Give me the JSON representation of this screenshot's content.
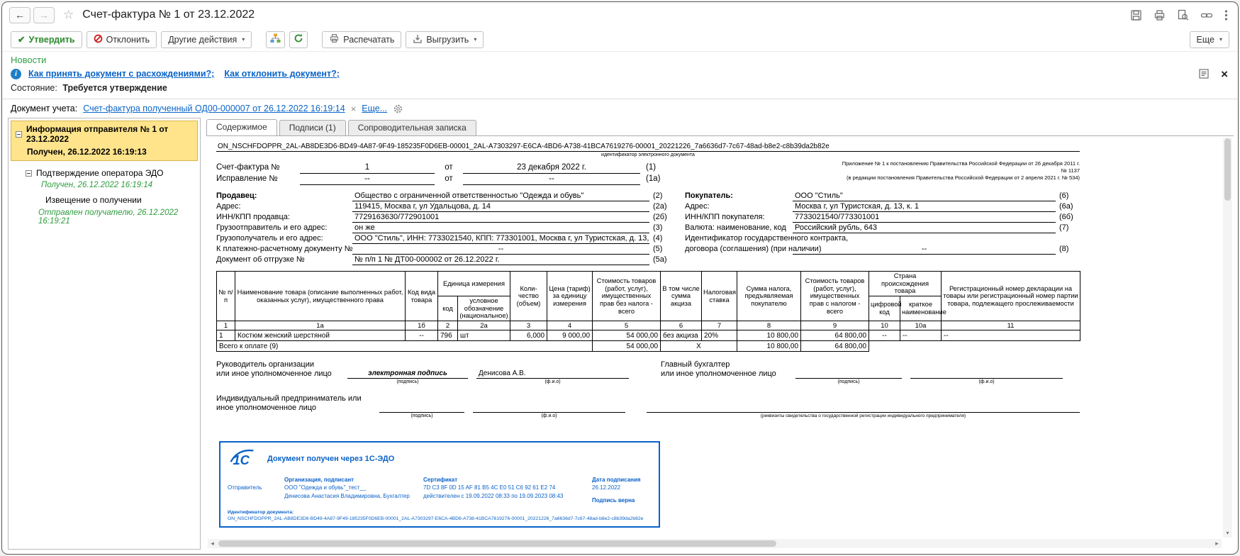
{
  "colors": {
    "accent_green": "#2e9e3e",
    "link_blue": "#0a64c8",
    "selected_yellow": "#ffe48c",
    "stamp_blue": "#0a62c8",
    "reject_red": "#cc2222"
  },
  "window": {
    "title": "Счет-фактура № 1 от 23.12.2022"
  },
  "toolbar": {
    "approve": "Утвердить",
    "reject": "Отклонить",
    "other_actions": "Другие действия",
    "print": "Распечатать",
    "export": "Выгрузить",
    "more": "Еще"
  },
  "news": {
    "title": "Новости",
    "link1": "Как принять документ с расхождениями?;",
    "link2": "Как отклонить документ?;"
  },
  "status_line": {
    "label": "Состояние:",
    "value": "Требуется утверждение"
  },
  "doc_line": {
    "label": "Документ учета:",
    "link": "Счет-фактура полученный ОД00-000007 от 26.12.2022 16:19:14",
    "close": "×",
    "more": "Еще..."
  },
  "tree": {
    "item1": {
      "title": "Информация отправителя № 1 от 23.12.2022",
      "status": "Получен, 26.12.2022 16:19:13"
    },
    "item2": {
      "title": "Подтверждение оператора ЭДО",
      "status": "Получен, 26.12.2022 16:19:14"
    },
    "item3": {
      "title": "Извещение о получении",
      "status": "Отправлен получателю, 26.12.2022 16:19:21"
    }
  },
  "tabs": {
    "t1": "Содержимое",
    "t2": "Подписи (1)",
    "t3": "Сопроводительная записка"
  },
  "invoice": {
    "doc_id": "ON_NSCHFDOPPR_2AL-AB8DE3D6-BD49-4A87-9F49-185235F0D6EB-00001_2AL-A7303297-E6CA-4BD6-A738-41BCA7619276-00001_20221226_7a6636d7-7c67-48ad-b8e2-c8b39da2b82e",
    "doc_id_caption": "идентификатор электронного документа",
    "reg1": "Приложение № 1 к постановлению Правительства Российской Федерации от 26 декабря 2011 г. № 1137",
    "reg2": "(в редакции постановления Правительства Российской Федерации от 2 апреля 2021 г. № 534)",
    "head": {
      "l1": "Счет-фактура №",
      "no": "1",
      "ot1": "от",
      "date": "23 декабря 2022 г.",
      "m1": "(1)",
      "l2": "Исправление №",
      "cno": "--",
      "ot2": "от",
      "cdate": "--",
      "m2": "(1а)"
    },
    "seller": [
      {
        "label": "Продавец:",
        "value": "Общество с ограниченной ответственностью \"Одежда и обувь\"",
        "mark": "(2)"
      },
      {
        "label": "Адрес:",
        "value": "119415, Москва г, ул Удальцова, д. 14",
        "mark": "(2а)"
      },
      {
        "label": "ИНН/КПП продавца:",
        "value": "7729163630/772901001",
        "mark": "(2б)"
      },
      {
        "label": "Грузоотправитель и его адрес:",
        "value": "он же",
        "mark": "(3)"
      },
      {
        "label": "Грузополучатель и его адрес:",
        "value": "ООО \"Стиль\", ИНН: 7733021540, КПП: 773301001, Москва г, ул Туристская, д. 13, к. 1",
        "mark": "(4)"
      },
      {
        "label": "К платежно-расчетному документу №",
        "value": "--",
        "mark": "(5)"
      },
      {
        "label": "Документ об отгрузке №",
        "value": "№ п/п 1 № ДТ00-000002 от 26.12.2022 г.",
        "mark": "(5а)"
      }
    ],
    "buyer": [
      {
        "label": "Покупатель:",
        "value": "ООО \"Стиль\"",
        "mark": "(6)"
      },
      {
        "label": "Адрес:",
        "value": "Москва г, ул Туристская, д. 13, к. 1",
        "mark": "(6а)"
      },
      {
        "label": "ИНН/КПП покупателя:",
        "value": "7733021540/773301001",
        "mark": "(6б)"
      },
      {
        "label": "Валюта: наименование, код",
        "value": "Российский рубль, 643",
        "mark": "(7)"
      },
      {
        "label": "Идентификатор государственного контракта,",
        "value": "",
        "mark": ""
      },
      {
        "label": "договора (соглашения) (при наличии)",
        "value": "--",
        "mark": "(8)"
      }
    ],
    "table": {
      "h": {
        "num": "№ п/п",
        "name": "Наименование товара (описание выполненных работ, оказанных услуг), имущественного права",
        "kind": "Код вида товара",
        "unit": "Единица измерения",
        "unit_code": "код",
        "unit_name": "условное обозначение (национальное)",
        "qty": "Коли- чество (объем)",
        "price": "Цена (тариф) за единицу измерения",
        "cost": "Стоимость товаров (работ, услуг), имущественных прав без налога - всего",
        "excise": "В том числе сумма акциза",
        "rate": "Налоговая ставка",
        "tax": "Сумма налога, предъявляемая покупателю",
        "cost_tax": "Стоимость товаров (работ, услуг), имущественных прав с налогом - всего",
        "country": "Страна происхождения товара",
        "c_code": "цифровой код",
        "c_name": "краткое наименование",
        "reg": "Регистрационный номер декларации на товары или регистрационный номер партии товара, подлежащего прослеживаемости"
      },
      "sub": [
        "1",
        "1а",
        "1б",
        "2",
        "2а",
        "3",
        "4",
        "5",
        "6",
        "7",
        "8",
        "9",
        "10",
        "10а",
        "11"
      ],
      "row": [
        "1",
        "Костюм женский шерстяной",
        "--",
        "796",
        "шт",
        "6,000",
        "9 000,00",
        "54 000,00",
        "без акциза",
        "20%",
        "10 800,00",
        "64 800,00",
        "--",
        "--",
        "--"
      ],
      "total": {
        "label": "Всего к оплате (9)",
        "cost": "54 000,00",
        "x": "X",
        "tax": "10 800,00",
        "cost_tax": "64 800,00"
      }
    },
    "sign": {
      "head1": "Руководитель организации",
      "head2": "или иное уполномоченное лицо",
      "esign": "электронная подпись",
      "cap_sign": "(подпись)",
      "head_name": "Денисова А.В.",
      "cap_name": "(ф.и.о)",
      "acc1": "Главный бухгалтер",
      "acc2": "или иное уполномоченное лицо",
      "ip1": "Индивидуальный предприниматель или",
      "ip2": "иное уполномоченное лицо",
      "cap_reg": "(реквизиты свидетельства о государственной регистрации индивидуального предпринимателя)"
    },
    "stamp": {
      "logo": "1С",
      "title": "Документ получен через 1С-ЭДО",
      "sender": "Отправитель",
      "org_h": "Организация, подписант",
      "org1": "ООО \"Одежда и обувь\"_тест__",
      "org2": "Денисова Анастасия Владимировна, Бухгалтер",
      "cert_h": "Сертификат",
      "cert1": "7D C3 8F 0D 15 AF 81 B5 4C E0 51 C6 92 61 E2 74",
      "cert2": "действителен с 19.09.2022 08:33 по 19.09.2023 08:43",
      "date_h": "Дата подписания",
      "date": "26.12.2022",
      "valid": "Подпись верна",
      "id_label": "Идентификатор документа:",
      "id": "ON_NSCHFDOPPR_2AL-AB8DE3D6-BD49-4A87-9F49-185235F0D6EB-00001_2AL-A7303297-E6CA-4BD6-A738-41BCA7619276-00001_20221226_7a6636d7-7c67-48ad-b8e2-c8b39da2b82e"
    }
  }
}
